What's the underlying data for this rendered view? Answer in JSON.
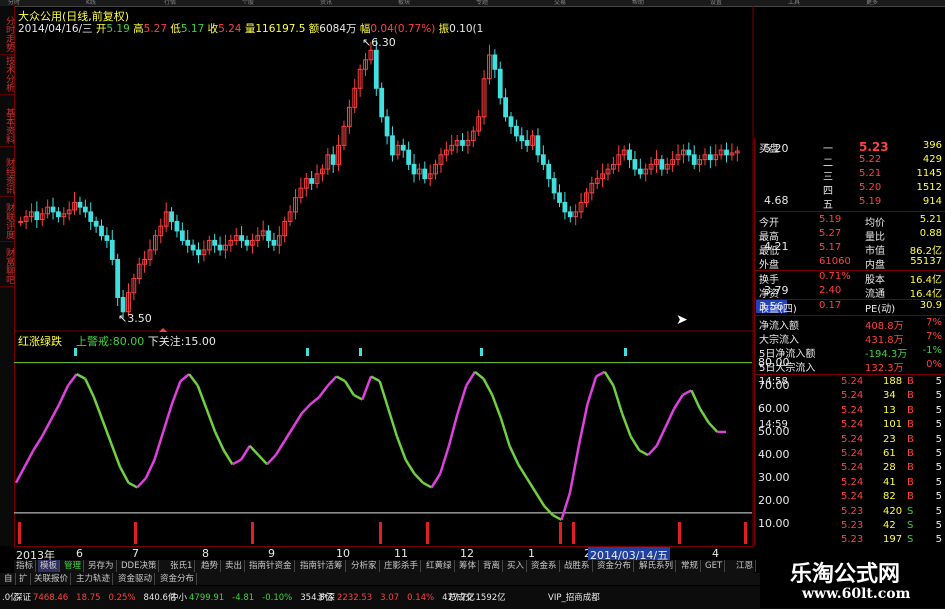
{
  "top_tabs": [
    "分时",
    "K线",
    "行情",
    "个股",
    "资讯",
    "板块",
    "专题",
    "交易",
    "帮助",
    "设置",
    "工具",
    "更多"
  ],
  "left_tabs": [
    "分时走势",
    "技术分析",
    "基本资料",
    "财经资讯",
    "财联评度",
    "财富聊吧"
  ],
  "header": {
    "name": "大众公用",
    "mode": "(日线,前复权)",
    "date": "2014/04/16/三",
    "open_label": "开",
    "open": "5.19",
    "high_label": "高",
    "high": "5.27",
    "low_label": "低",
    "low": "5.17",
    "close_label": "收",
    "close": "5.24",
    "vol_label": "量",
    "vol": "116197.5",
    "amt_label": "额",
    "amt": "6084万",
    "chg_label": "幅",
    "chg": "0.04(0.77%)",
    "amp_label": "振",
    "amp": "0.10(1"
  },
  "price_axis": {
    "labels": [
      "5.20",
      "4.68",
      "4.21",
      "3.79"
    ],
    "current": "3.56"
  },
  "annotations": {
    "high": "6.30",
    "low": "3.50"
  },
  "indicator": {
    "name": "红涨绿跌",
    "upper_label": "上警戒:",
    "upper": "80.00",
    "lower_label": "下关注:",
    "lower": "15.00",
    "axis": [
      "80.00",
      "70.00",
      "60.00",
      "50.00",
      "40.00",
      "30.00",
      "20.00",
      "10.00"
    ]
  },
  "x_axis": {
    "year": "2013年",
    "months": [
      "6",
      "7",
      "8",
      "9",
      "10",
      "11",
      "12",
      "1",
      "2",
      "4"
    ],
    "cursor_date": "2014/03/14/五"
  },
  "order_book": {
    "label": "买盘",
    "levels": [
      {
        "name": "一",
        "price": "5.23",
        "vol": "396"
      },
      {
        "name": "二",
        "price": "5.22",
        "vol": "429"
      },
      {
        "name": "三",
        "price": "5.21",
        "vol": "1145"
      },
      {
        "name": "四",
        "price": "5.20",
        "vol": "1512"
      },
      {
        "name": "五",
        "price": "5.19",
        "vol": "914"
      }
    ]
  },
  "stats": [
    {
      "k1": "今开",
      "v1": "5.19",
      "k2": "均价",
      "v2": "5.21"
    },
    {
      "k1": "最高",
      "v1": "5.27",
      "k2": "量比",
      "v2": "0.88"
    },
    {
      "k1": "最低",
      "v1": "5.17",
      "k2": "市值",
      "v2": "86.2亿"
    },
    {
      "k1": "外盘",
      "v1": "61060",
      "k2": "内盘",
      "v2": "55137"
    },
    {
      "k1": "换手",
      "v1": "0.71%",
      "k2": "股本",
      "v2": "16.4亿"
    },
    {
      "k1": "净资",
      "v1": "2.40",
      "k2": "流通",
      "v2": "16.4亿"
    },
    {
      "k1": "收益(四)",
      "v1": "0.17",
      "k2": "PE(动)",
      "v2": "30.9"
    }
  ],
  "flows": [
    {
      "label": "净流入额",
      "value": "408.8万",
      "pct": "7%"
    },
    {
      "label": "大宗流入",
      "value": "431.8万",
      "pct": "7%"
    },
    {
      "label": "5日净流入额",
      "value": "-194.3万",
      "pct": "-1%"
    },
    {
      "label": "5日大宗流入",
      "value": "132.3万",
      "pct": "0%"
    }
  ],
  "ticks": [
    {
      "time": "14:58",
      "price": "5.24",
      "vol": "188",
      "side": "B",
      "n": "5"
    },
    {
      "time": "",
      "price": "5.24",
      "vol": "34",
      "side": "B",
      "n": "5"
    },
    {
      "time": "",
      "price": "5.24",
      "vol": "13",
      "side": "B",
      "n": "5"
    },
    {
      "time": "14:59",
      "price": "5.24",
      "vol": "101",
      "side": "B",
      "n": "5"
    },
    {
      "time": "",
      "price": "5.24",
      "vol": "23",
      "side": "B",
      "n": "5"
    },
    {
      "time": "",
      "price": "5.24",
      "vol": "61",
      "side": "B",
      "n": "5"
    },
    {
      "time": "",
      "price": "5.24",
      "vol": "28",
      "side": "B",
      "n": "5"
    },
    {
      "time": "",
      "price": "5.24",
      "vol": "41",
      "side": "B",
      "n": "5"
    },
    {
      "time": "",
      "price": "5.24",
      "vol": "82",
      "side": "B",
      "n": "5"
    },
    {
      "time": "",
      "price": "5.23",
      "vol": "420",
      "side": "S",
      "n": "5"
    },
    {
      "time": "",
      "price": "5.23",
      "vol": "42",
      "side": "S",
      "n": "5"
    },
    {
      "time": "",
      "price": "5.23",
      "vol": "197",
      "side": "S",
      "n": "5"
    },
    {
      "time": "",
      "price": "5.24",
      "vol": "104",
      "side": "S",
      "n": "5"
    }
  ],
  "bottom_tabs": [
    "指标",
    "模板",
    "管理",
    "另存为",
    "DDE决策",
    "张氏1",
    "趋势",
    "卖出",
    "指南针资金",
    "指南针活筹",
    "分析家",
    "庄影杀手",
    "红黄绿",
    "筹体",
    "背离",
    "买入",
    "资金系",
    "战胜系",
    "资金分布",
    "解氏系列",
    "常规",
    "GET",
    "江恩",
    "筹码"
  ],
  "bottom_tabs2": [
    "自",
    "扩",
    "关联报价",
    "主力轨迹",
    "资金驱动",
    "资金分布"
  ],
  "status": [
    {
      "label": "",
      "value": ".0亿"
    },
    {
      "label": "深证",
      "value": "7468.46",
      "chg": "18.75",
      "pct": "0.25%",
      "amt": "840.6亿"
    },
    {
      "label": "中小",
      "value": "4799.91",
      "chg": "-4.81",
      "pct": "-0.10%",
      "amt": "354.8亿"
    },
    {
      "label": "沪深",
      "value": "2232.53",
      "chg": "3.07",
      "pct": "0.14%",
      "amt": "477.7亿"
    },
    {
      "label": "总成交",
      "value": "1592亿"
    },
    {
      "label": "VIP_招商成都",
      "value": ""
    }
  ],
  "watermark": {
    "title": "乐淘公式网",
    "url": "www.60lt.com"
  },
  "colors": {
    "up": "#ff4040",
    "down": "#40e0e0",
    "rise": "#e040e0",
    "fall": "#70d040",
    "grid": "#7a0000",
    "signal": "#40e0e0"
  },
  "candles": [
    4.5,
    4.55,
    4.6,
    4.52,
    4.58,
    4.65,
    4.6,
    4.55,
    4.58,
    4.62,
    4.7,
    4.65,
    4.6,
    4.5,
    4.45,
    4.35,
    4.3,
    4.1,
    3.7,
    3.55,
    3.75,
    3.9,
    4.05,
    4.1,
    4.2,
    4.35,
    4.45,
    4.6,
    4.5,
    4.4,
    4.3,
    4.25,
    4.2,
    4.15,
    4.2,
    4.3,
    4.25,
    4.2,
    4.25,
    4.3,
    4.35,
    4.3,
    4.25,
    4.3,
    4.35,
    4.4,
    4.3,
    4.25,
    4.35,
    4.5,
    4.6,
    4.75,
    4.85,
    4.95,
    4.9,
    5.0,
    5.05,
    5.2,
    5.1,
    5.3,
    5.5,
    5.7,
    5.9,
    6.1,
    6.2,
    6.3,
    5.9,
    5.6,
    5.4,
    5.2,
    5.3,
    5.25,
    5.1,
    5.0,
    5.05,
    4.95,
    5.0,
    5.1,
    5.2,
    5.25,
    5.3,
    5.35,
    5.3,
    5.35,
    5.45,
    5.6,
    6.0,
    6.25,
    6.1,
    5.8,
    5.6,
    5.5,
    5.4,
    5.35,
    5.3,
    5.4,
    5.2,
    5.1,
    4.95,
    4.8,
    4.7,
    4.6,
    4.55,
    4.6,
    4.7,
    4.8,
    4.9,
    4.95,
    5.0,
    5.05,
    5.1,
    5.2,
    5.25,
    5.15,
    5.05,
    5.0,
    5.05,
    5.1,
    5.15,
    5.05,
    5.1,
    5.15,
    5.2,
    5.25,
    5.2,
    5.1,
    5.15,
    5.2,
    5.15,
    5.2,
    5.25,
    5.2,
    5.22,
    5.24
  ],
  "osc": [
    28,
    35,
    42,
    48,
    55,
    62,
    70,
    75,
    73,
    65,
    55,
    45,
    35,
    28,
    26,
    30,
    38,
    50,
    62,
    72,
    75,
    70,
    60,
    50,
    42,
    36,
    38,
    44,
    40,
    36,
    40,
    46,
    52,
    58,
    62,
    65,
    70,
    74,
    72,
    66,
    64,
    74,
    72,
    60,
    48,
    38,
    32,
    28,
    26,
    32,
    44,
    58,
    70,
    76,
    73,
    66,
    56,
    44,
    36,
    30,
    24,
    18,
    14,
    12,
    24,
    44,
    62,
    74,
    76,
    70,
    58,
    48,
    42,
    40,
    44,
    52,
    60,
    66,
    68,
    60,
    54,
    50,
    50
  ]
}
